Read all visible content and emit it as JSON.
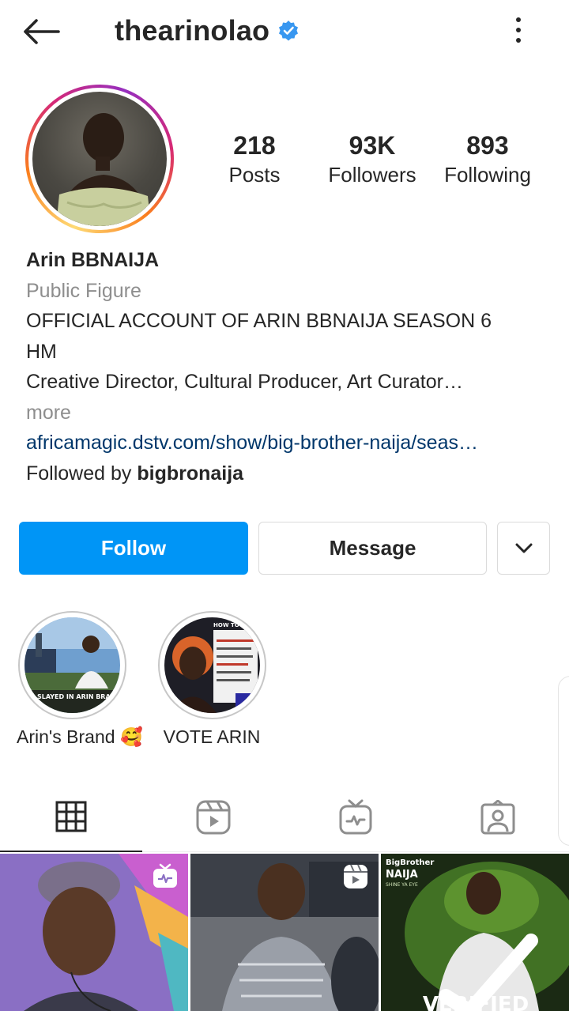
{
  "header": {
    "username": "thearinolao",
    "verified": true
  },
  "profile": {
    "stats": [
      {
        "value": "218",
        "label": "Posts"
      },
      {
        "value": "93K",
        "label": "Followers"
      },
      {
        "value": "893",
        "label": "Following"
      }
    ],
    "name": "Arin BBNAIJA",
    "category": "Public Figure",
    "bio_line1": "OFFICIAL ACCOUNT OF ARIN BBNAIJA SEASON 6",
    "bio_line2": "HM",
    "bio_line3": "Creative Director, Cultural Producer, Art Curator…",
    "more": "more",
    "link": "africamagic.dstv.com/show/big-brother-naija/seas…",
    "followed_by_prefix": "Followed by",
    "followed_by_user": "bigbronaija"
  },
  "actions": {
    "follow": "Follow",
    "message": "Message"
  },
  "highlights": [
    {
      "label": "Arin's Brand 🥰",
      "caption": "ES STARS SLAYED IN ARIN BRAND NOLA"
    },
    {
      "label": "VOTE ARIN",
      "caption": "HOW TO VOTE"
    }
  ],
  "tabs": [
    {
      "name": "posts-grid",
      "active": true
    },
    {
      "name": "reels",
      "active": false
    },
    {
      "name": "igtv",
      "active": false
    },
    {
      "name": "tagged",
      "active": false
    }
  ],
  "posts": [
    {
      "type": "igtv"
    },
    {
      "type": "reel"
    },
    {
      "type": "image",
      "title": "BigBrother",
      "subtitle": "NAIJA",
      "tagline": "SHINE YA EYE",
      "caption": "VERIFIED"
    }
  ],
  "colors": {
    "primary_blue": "#0095f6",
    "link_blue": "#00376b",
    "muted": "#8e8e8e",
    "text": "#262626",
    "verified_blue": "#3897f0"
  }
}
